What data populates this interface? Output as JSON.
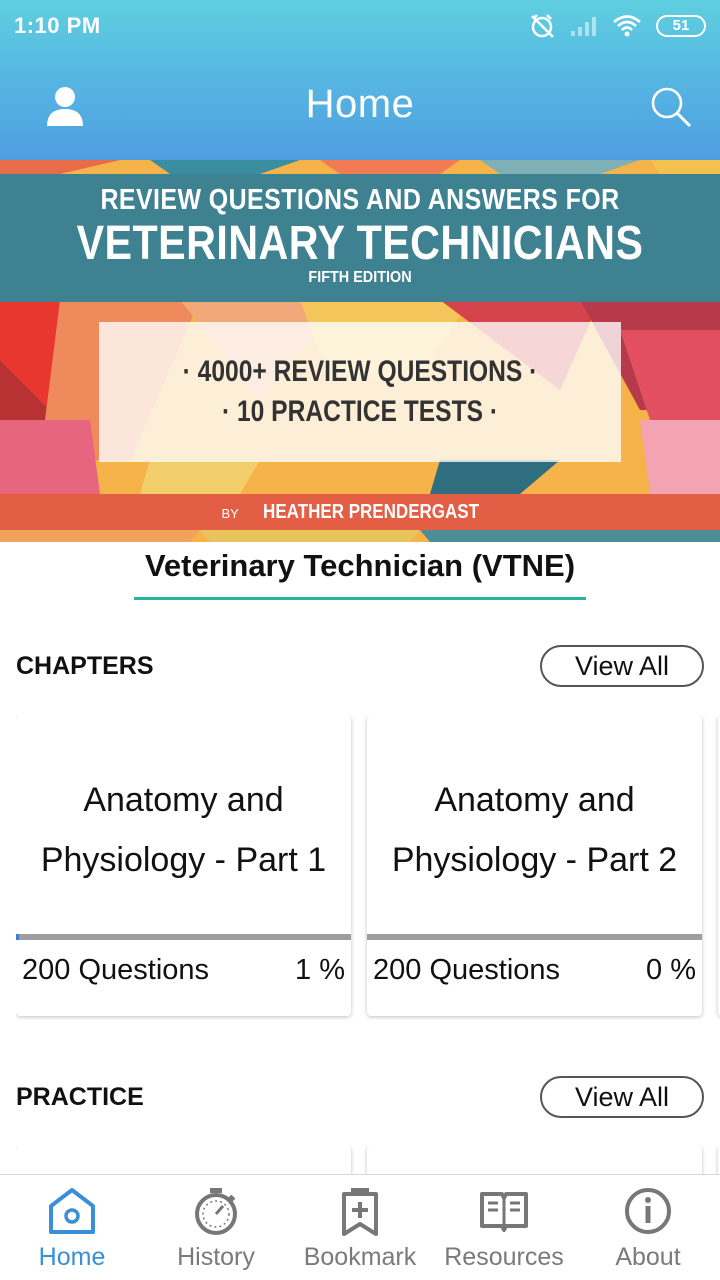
{
  "status_bar": {
    "time": "1:10 PM",
    "battery": "51"
  },
  "header": {
    "title": "Home"
  },
  "banner": {
    "line1": "REVIEW QUESTIONS AND ANSWERS FOR",
    "line2": "VETERINARY TECHNICIANS",
    "line3": "FIFTH EDITION",
    "box_line1": "· 4000+ REVIEW QUESTIONS ·",
    "box_line2": "· 10 PRACTICE TESTS ·",
    "by": "BY",
    "author": "HEATHER PRENDERGAST"
  },
  "course_title": "Veterinary Technician (VTNE)",
  "chapters": {
    "title": "CHAPTERS",
    "view_all": "View All",
    "items": [
      {
        "line1": "Anatomy and",
        "line2": "Physiology - Part 1",
        "questions": "200 Questions",
        "percent": "1 %",
        "progress": 0.01
      },
      {
        "line1": "Anatomy and",
        "line2": "Physiology - Part 2",
        "questions": "200 Questions",
        "percent": "0 %",
        "progress": 0.0
      }
    ]
  },
  "practice": {
    "title": "PRACTICE",
    "view_all": "View All"
  },
  "nav": {
    "items": [
      {
        "label": "Home",
        "icon": "home-icon",
        "active": true
      },
      {
        "label": "History",
        "icon": "stopwatch-icon",
        "active": false
      },
      {
        "label": "Bookmark",
        "icon": "bookmark-add-icon",
        "active": false
      },
      {
        "label": "Resources",
        "icon": "book-icon",
        "active": false
      },
      {
        "label": "About",
        "icon": "info-icon",
        "active": false
      }
    ]
  },
  "colors": {
    "accent": "#3a8fd8",
    "underline": "#2ab4a0",
    "banner_teal": "#3e8190",
    "banner_red": "#e35e44"
  }
}
